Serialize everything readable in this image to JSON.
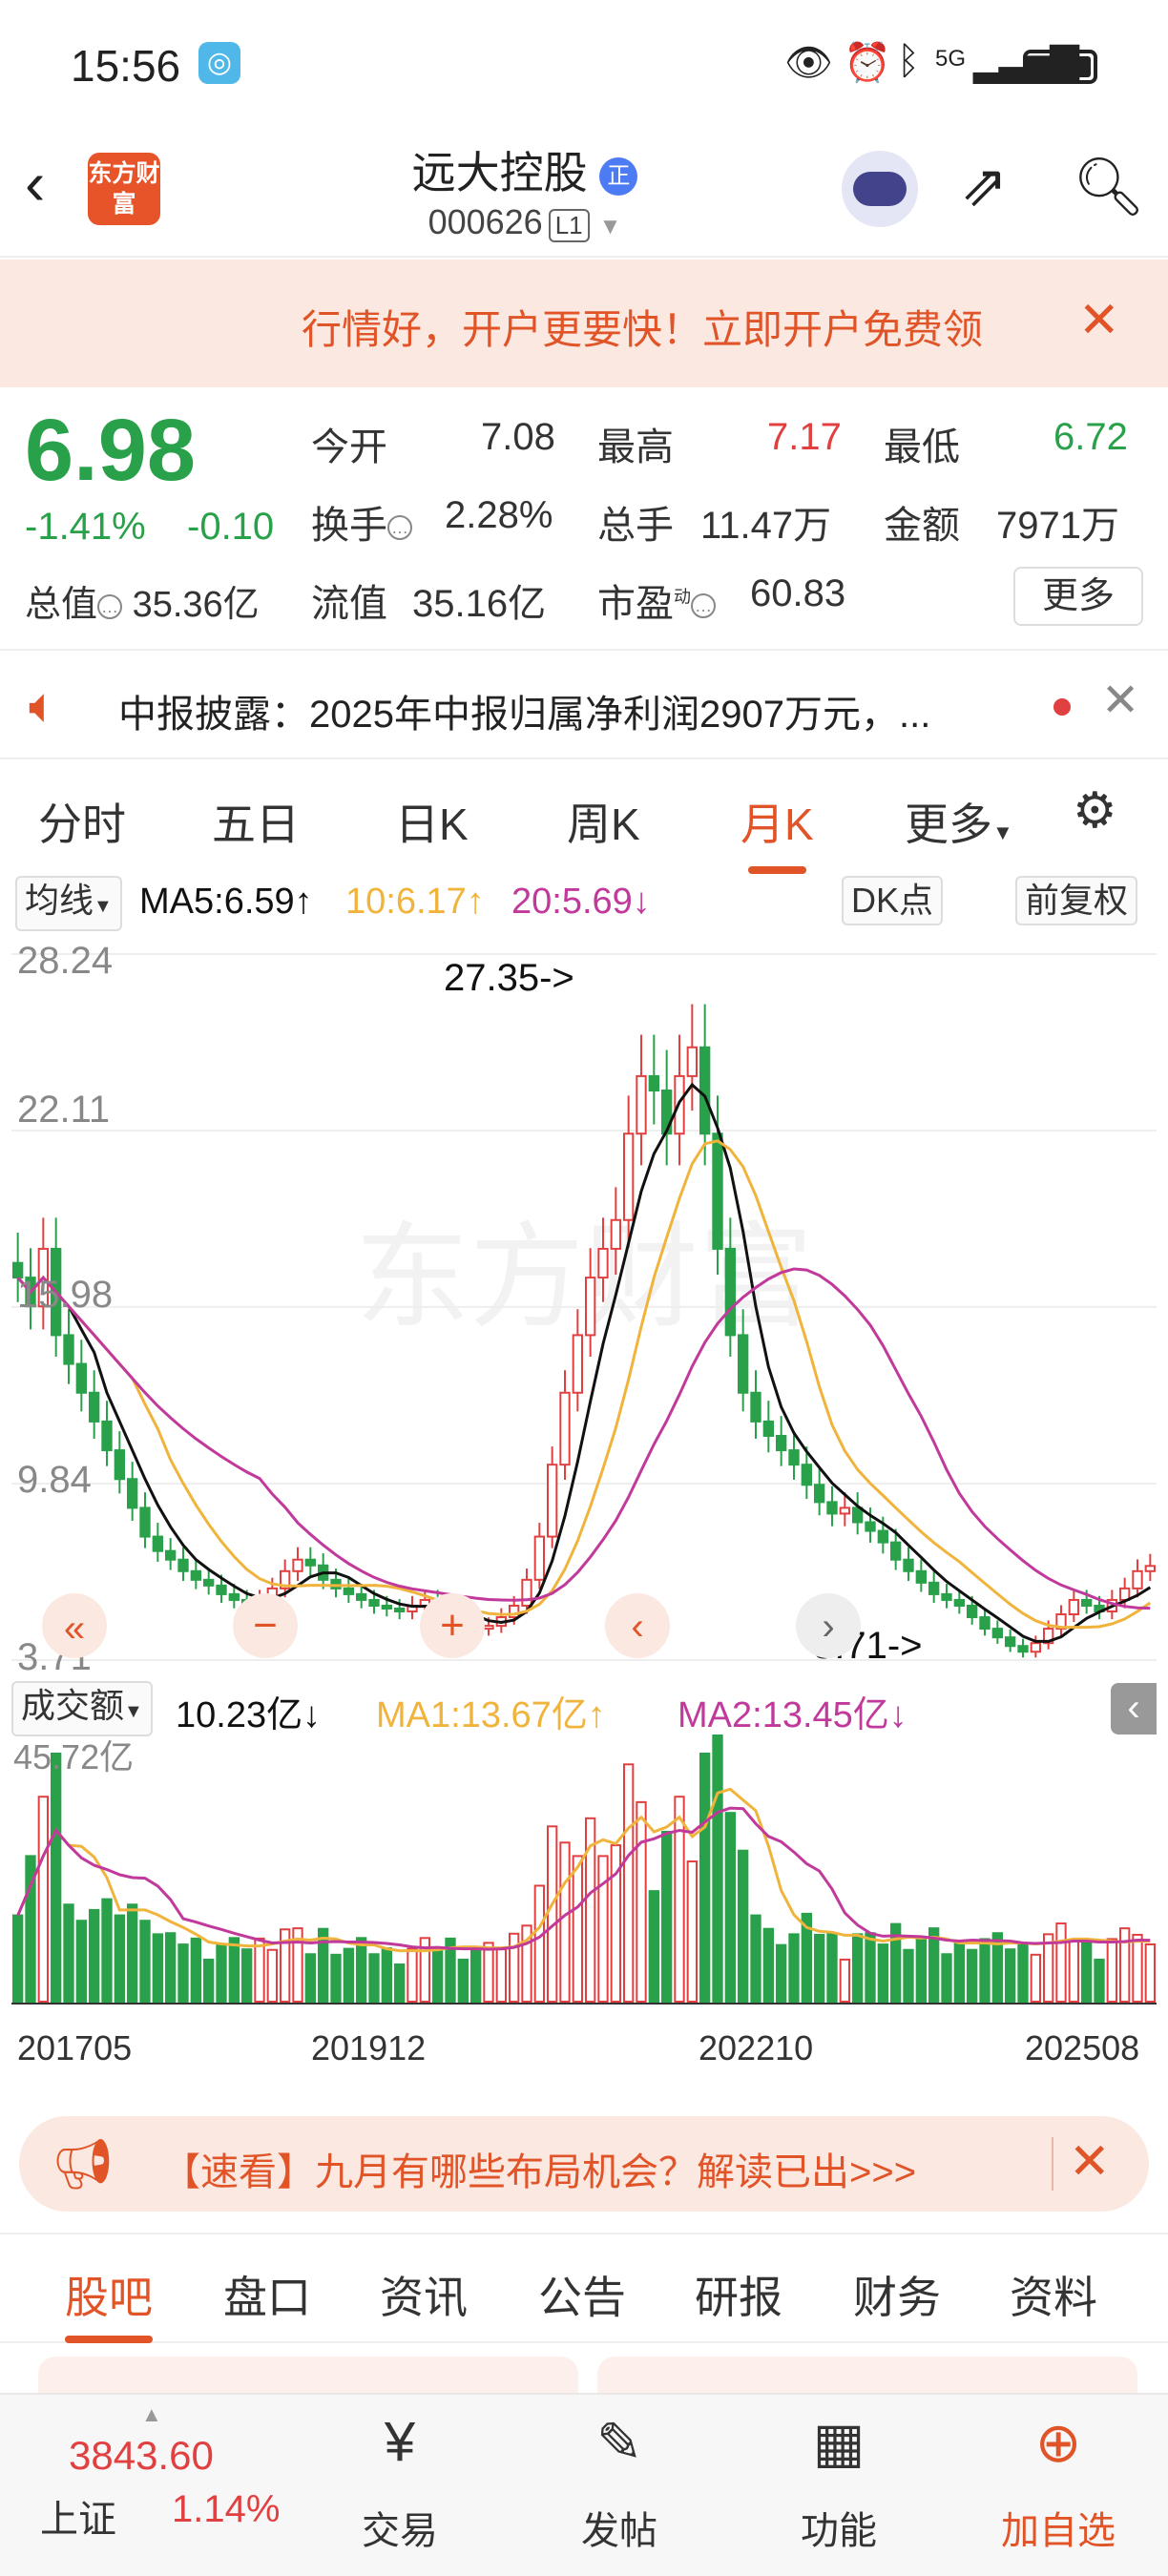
{
  "status": {
    "time": "15:56",
    "network": "5G"
  },
  "header": {
    "logo_text": "东方财富",
    "stock_name": "远大控股",
    "name_badge": "正",
    "code": "000626",
    "level": "L1"
  },
  "banner": {
    "text": "行情好，开户更要快！立即开户免费领"
  },
  "quote": {
    "price": "6.98",
    "change_pct": "-1.41%",
    "change": "-0.10",
    "open_label": "今开",
    "open": "7.08",
    "high_label": "最高",
    "high": "7.17",
    "low_label": "最低",
    "low": "6.72",
    "turnover_label": "换手",
    "turnover": "2.28%",
    "volume_label": "总手",
    "volume": "11.47万",
    "amount_label": "金额",
    "amount": "7971万",
    "mktcap_label": "总值",
    "mktcap": "35.36亿",
    "float_label": "流值",
    "float_cap": "35.16亿",
    "pe_label": "市盈",
    "pe_sup": "动",
    "pe": "60.83",
    "more_label": "更多"
  },
  "notice": {
    "text": "中报披露：2025年中报归属净利润2907万元，..."
  },
  "tabs": [
    "分时",
    "五日",
    "日K",
    "周K",
    "月K",
    "更多"
  ],
  "active_tab": 4,
  "ma_line": {
    "selector": "均线",
    "ma5": "MA5:6.59↑",
    "ma10": "10:6.17↑",
    "ma20": "20:5.69↓",
    "dk": "DK点",
    "adjust": "前复权"
  },
  "kchart_labels": {
    "y_top": "28.24",
    "y2": "22.11",
    "y3": "15.98",
    "y4": "9.84",
    "y_bottom": "3.71",
    "max_note": "27.35->",
    "min_note": "3.71->"
  },
  "vol_line": {
    "selector": "成交额",
    "value": "10.23亿↓",
    "ma1": "MA1:13.67亿↑",
    "ma2": "MA2:13.45亿↓",
    "y_top": "45.72亿"
  },
  "x_ticks": [
    "201705",
    "201912",
    "202210",
    "202508"
  ],
  "ad": {
    "text": "【速看】九月有哪些布局机会？解读已出>>>"
  },
  "subtabs": [
    "股吧",
    "盘口",
    "资讯",
    "公告",
    "研报",
    "财务",
    "资料"
  ],
  "bottom": {
    "index_value": "3843.60",
    "index_name": "上证",
    "index_change": "1.14%",
    "trade": "交易",
    "post": "发帖",
    "function": "功能",
    "add": "加自选"
  },
  "colors": {
    "up": "#e04040",
    "down": "#29a14a",
    "accent": "#e05428",
    "ma5": "#111111",
    "ma10": "#f0b43c",
    "ma20": "#c0399b"
  },
  "chart_data": {
    "type": "candlestick",
    "title": "",
    "period": "monthly",
    "x_range": [
      "201705",
      "202508"
    ],
    "ylim": [
      3.71,
      28.24
    ],
    "y_ticks": [
      28.24,
      22.11,
      15.98,
      9.84,
      3.71
    ],
    "candles_close_approx": [
      17,
      16,
      18,
      15,
      14,
      13,
      12,
      11,
      10,
      9,
      8,
      7.5,
      7.2,
      6.8,
      6.5,
      6.3,
      6,
      5.8,
      5.5,
      5.8,
      6.2,
      6.8,
      7.2,
      7,
      6.5,
      6.2,
      6,
      5.8,
      5.6,
      5.5,
      5.4,
      5.6,
      5.8,
      5.5,
      5.2,
      5,
      4.8,
      4.9,
      5.2,
      5.6,
      6.5,
      8,
      10.5,
      13,
      15,
      17,
      18,
      19,
      22,
      24,
      23.5,
      22,
      24,
      25,
      22,
      18,
      15,
      13,
      12,
      11.5,
      11,
      10.5,
      9.8,
      9.2,
      8.8,
      9,
      8.5,
      8.2,
      7.8,
      7.2,
      6.8,
      6.4,
      6,
      5.8,
      5.6,
      5.2,
      4.8,
      4.5,
      4.2,
      4,
      4.3,
      4.8,
      5.3,
      5.8,
      5.6,
      5.4,
      5.8,
      6.2,
      6.8,
      6.98
    ],
    "annotations": [
      {
        "label": "27.35",
        "type": "max"
      },
      {
        "label": "3.71",
        "type": "min"
      }
    ],
    "series": [
      {
        "name": "MA5",
        "last": 6.59
      },
      {
        "name": "MA10",
        "last": 6.17
      },
      {
        "name": "MA20",
        "last": 5.69
      }
    ],
    "volume": {
      "name": "成交额",
      "ylim_top": "45.72亿",
      "last": "10.23亿",
      "ma1": "13.67亿",
      "ma2": "13.45亿"
    }
  }
}
